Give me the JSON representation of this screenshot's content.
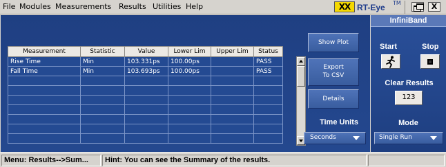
{
  "menu": [
    "File",
    "Modules",
    "Measurements",
    "Results",
    "Utilities",
    "Help"
  ],
  "app": {
    "logo": "XX",
    "title": "RT-Eye",
    "trademark": "TM",
    "close": "X"
  },
  "module": "InfiniBand",
  "table": {
    "headers": [
      "Measurement",
      "Statistic",
      "Value",
      "Lower Lim",
      "Upper Lim",
      "Status"
    ],
    "rows": [
      [
        "Rise Time",
        "Min",
        "103.331ps",
        "100.00ps",
        "",
        "PASS"
      ],
      [
        "Fall Time",
        "Min",
        "103.693ps",
        "100.00ps",
        "",
        "PASS"
      ]
    ]
  },
  "buttons": {
    "show_plot": "Show Plot",
    "export_line1": "Export",
    "export_line2": "To CSV",
    "details": "Details"
  },
  "time_units": {
    "label": "Time Units",
    "value": "Seconds"
  },
  "controls": {
    "start": "Start",
    "stop": "Stop",
    "clear_results": "Clear Results",
    "clear_icon": "123",
    "mode_label": "Mode",
    "mode_value": "Single Run"
  },
  "status": {
    "menu_path": "Menu: Results-->Sum...",
    "hint": "Hint: You can see the Summary of the results."
  }
}
